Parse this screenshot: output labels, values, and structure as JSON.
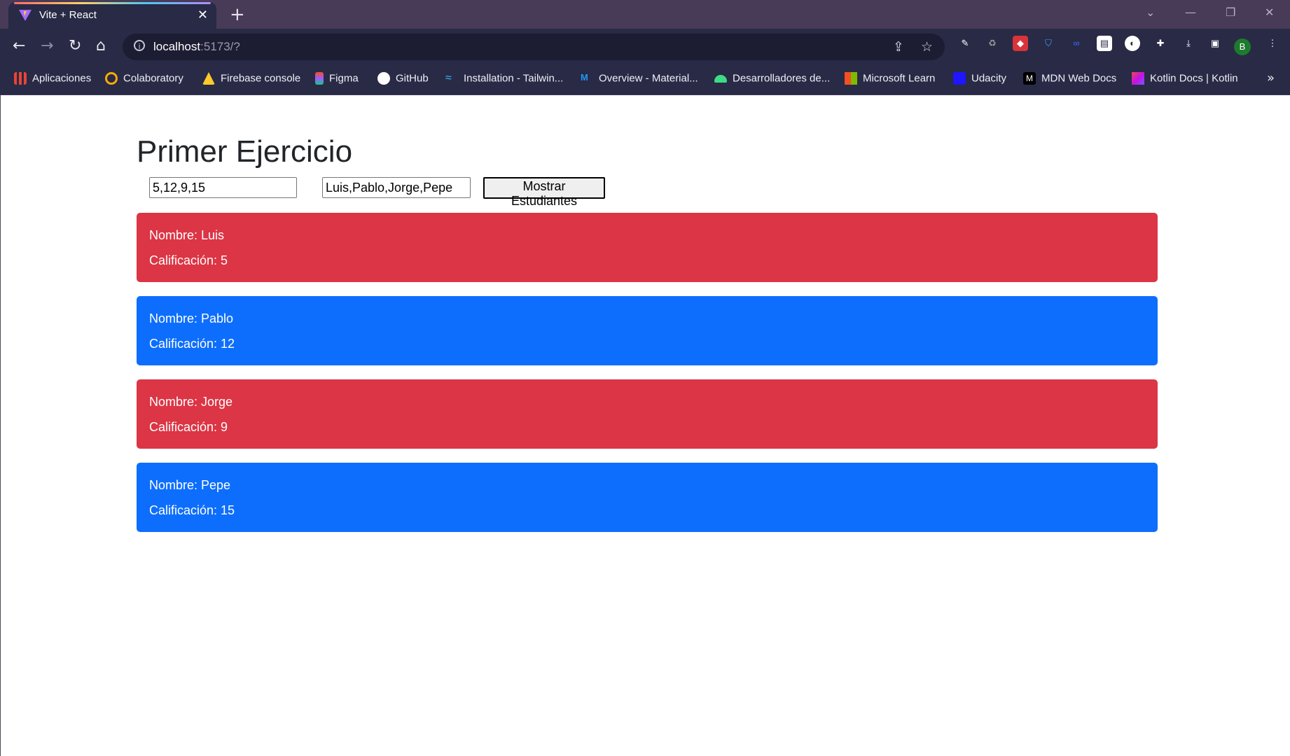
{
  "browser": {
    "tab_title": "Vite + React",
    "url_host": "localhost",
    "url_path": ":5173/?",
    "profile_initial": "B"
  },
  "bookmarks": [
    {
      "label": "Aplicaciones",
      "icon": "apps-grid-icon"
    },
    {
      "label": "Colaboratory",
      "icon": "colab-icon"
    },
    {
      "label": "Firebase console",
      "icon": "firebase-icon"
    },
    {
      "label": "Figma",
      "icon": "figma-icon"
    },
    {
      "label": "GitHub",
      "icon": "github-icon"
    },
    {
      "label": "Installation - Tailwin...",
      "icon": "tailwind-icon"
    },
    {
      "label": "Overview - Material...",
      "icon": "material-ui-icon"
    },
    {
      "label": "Desarrolladores de...",
      "icon": "android-icon"
    },
    {
      "label": "Microsoft Learn",
      "icon": "microsoft-icon"
    },
    {
      "label": "Udacity",
      "icon": "udacity-icon"
    },
    {
      "label": "MDN Web Docs",
      "icon": "mdn-icon"
    },
    {
      "label": "Kotlin Docs | Kotlin",
      "icon": "kotlin-icon"
    }
  ],
  "page": {
    "title": "Primer Ejercicio",
    "grades_input": "5,12,9,15",
    "names_input": "Luis,Pablo,Jorge,Pepe",
    "show_button": "Mostrar Estudiantes",
    "students": [
      {
        "name_line": "Nombre: Luis",
        "grade_line": "Calificación: 5",
        "color": "#dc3545"
      },
      {
        "name_line": "Nombre: Pablo",
        "grade_line": "Calificación: 12",
        "color": "#0d6efd"
      },
      {
        "name_line": "Nombre: Jorge",
        "grade_line": "Calificación: 9",
        "color": "#dc3545"
      },
      {
        "name_line": "Nombre: Pepe",
        "grade_line": "Calificación: 15",
        "color": "#0d6efd"
      }
    ]
  }
}
